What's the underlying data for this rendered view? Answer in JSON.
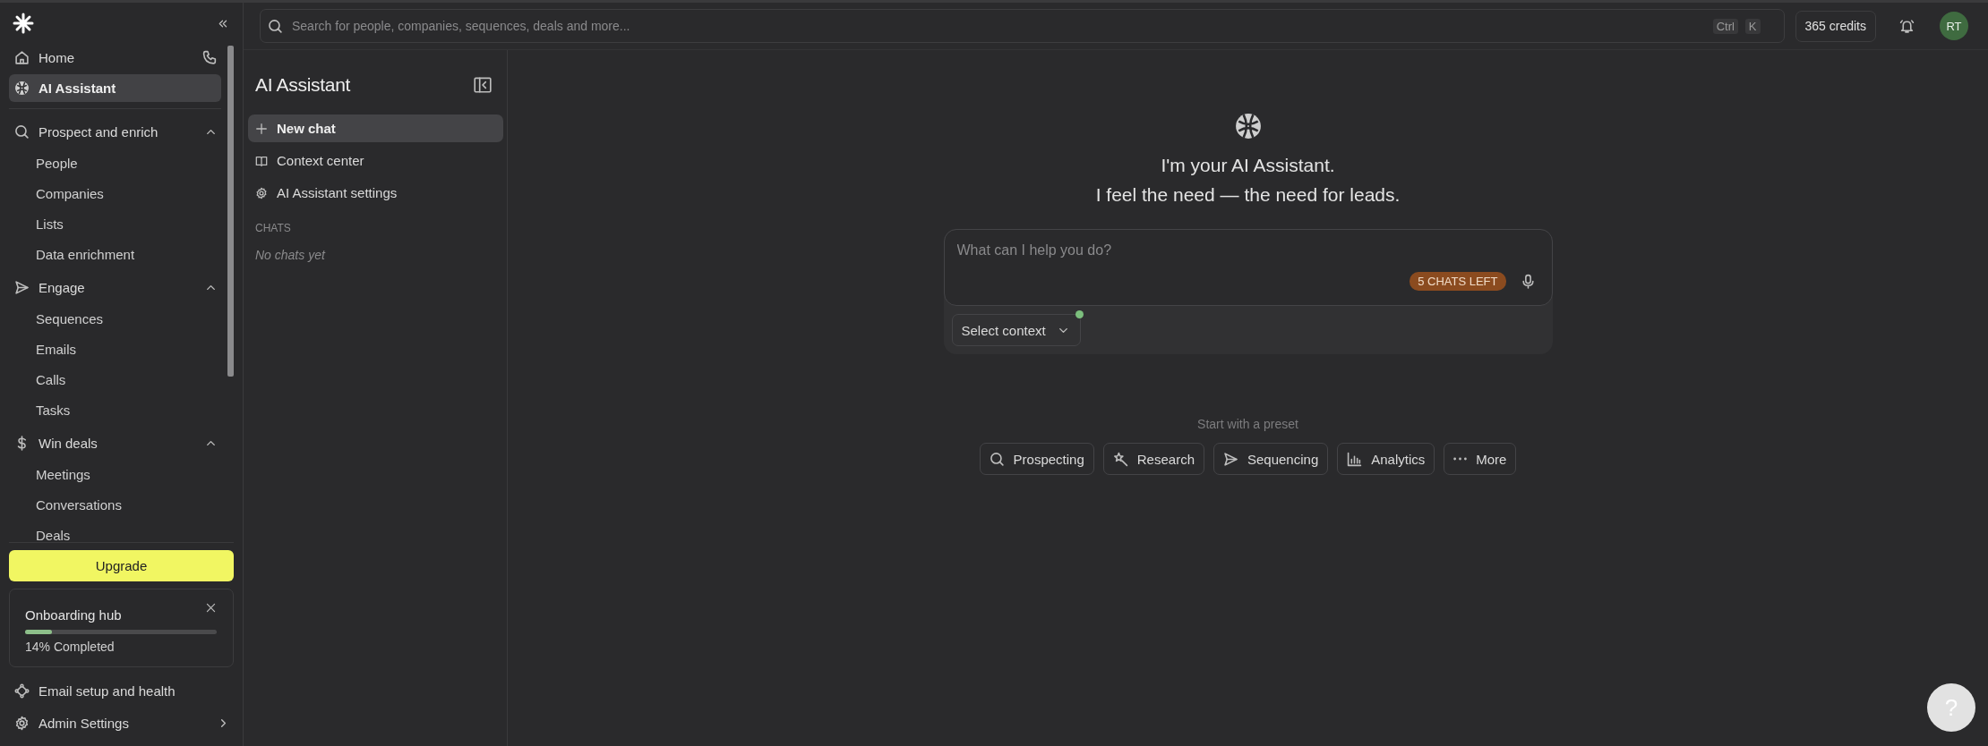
{
  "sidebar": {
    "items": [
      {
        "label": "Home",
        "selected": false
      },
      {
        "label": "AI Assistant",
        "selected": true
      }
    ],
    "sections": [
      {
        "label": "Prospect and enrich",
        "expanded": true,
        "children": [
          {
            "label": "People"
          },
          {
            "label": "Companies"
          },
          {
            "label": "Lists"
          },
          {
            "label": "Data enrichment"
          }
        ]
      },
      {
        "label": "Engage",
        "expanded": true,
        "children": [
          {
            "label": "Sequences"
          },
          {
            "label": "Emails"
          },
          {
            "label": "Calls"
          },
          {
            "label": "Tasks"
          }
        ]
      },
      {
        "label": "Win deals",
        "expanded": true,
        "children": [
          {
            "label": "Meetings"
          },
          {
            "label": "Conversations"
          },
          {
            "label": "Deals"
          }
        ]
      }
    ],
    "upgrade_button": "Upgrade",
    "onboarding": {
      "title": "Onboarding hub",
      "level": 0.14,
      "progress_text": "14% Completed"
    },
    "footer_items": [
      {
        "label": "Email setup and health"
      },
      {
        "label": "Admin Settings"
      }
    ]
  },
  "topbar": {
    "search": {
      "placeholder": "Search for people, companies, sequences, deals and more..."
    },
    "shortcut_keys": [
      "Ctrl",
      "K"
    ],
    "credits": "365 credits",
    "avatar": "RT"
  },
  "assistant_panel": {
    "title": "AI Assistant",
    "actions": [
      {
        "label": "New chat",
        "selected": true
      },
      {
        "label": "Context center",
        "selected": false
      },
      {
        "label": "AI Assistant settings",
        "selected": false
      }
    ],
    "chats_heading": "CHATS",
    "empty_text": "No chats yet"
  },
  "main": {
    "greeting": [
      "I'm your AI Assistant.",
      "I feel the need — the need for leads."
    ],
    "prompt": {
      "placeholder": "What can I help you do?",
      "badge": "5 CHATS LEFT",
      "context_button": "Select context"
    },
    "preset_label": "Start with a preset",
    "presets": [
      {
        "label": "Prospecting"
      },
      {
        "label": "Research"
      },
      {
        "label": "Sequencing"
      },
      {
        "label": "Analytics"
      },
      {
        "label": "More"
      }
    ],
    "help_button": "?"
  }
}
